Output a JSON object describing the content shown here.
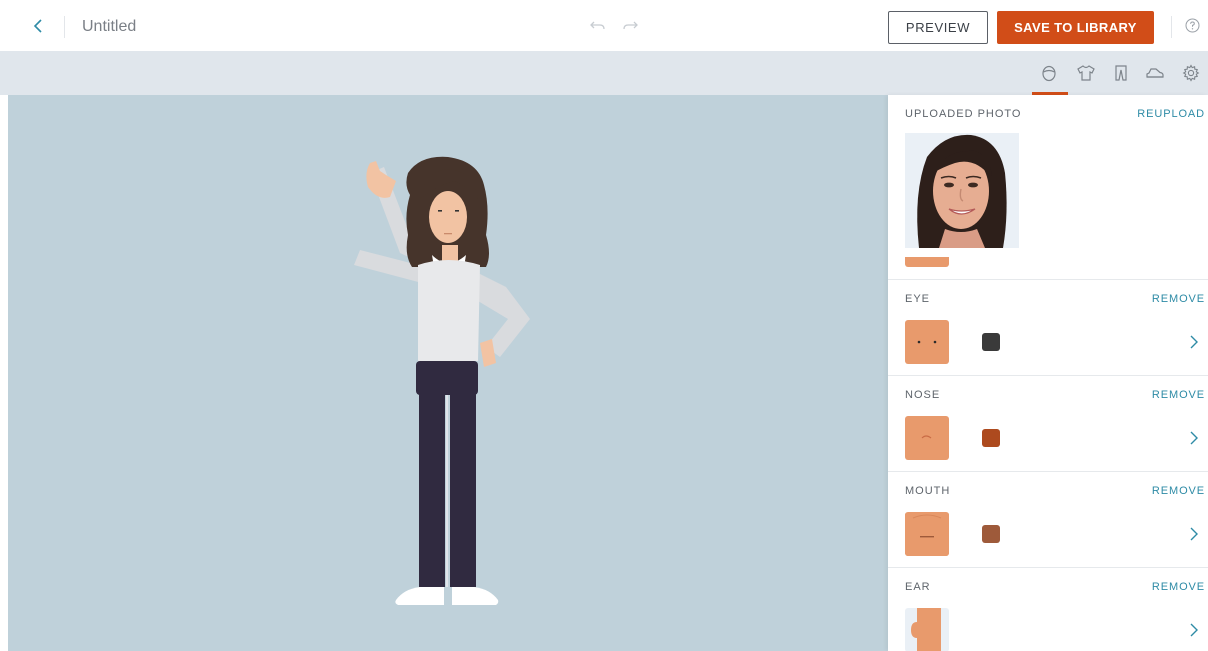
{
  "header": {
    "title": "Untitled",
    "preview_label": "PREVIEW",
    "save_label": "SAVE TO LIBRARY",
    "icons": {
      "back": "chevron-left-icon",
      "undo": "undo-icon",
      "redo": "redo-icon",
      "help": "help-icon"
    }
  },
  "tabs": [
    {
      "name": "face",
      "icon": "face-icon",
      "active": true
    },
    {
      "name": "top",
      "icon": "shirt-icon",
      "active": false
    },
    {
      "name": "bottom",
      "icon": "pants-icon",
      "active": false
    },
    {
      "name": "shoes",
      "icon": "shoe-icon",
      "active": false
    },
    {
      "name": "settings",
      "icon": "gear-icon",
      "active": false
    }
  ],
  "panel": {
    "uploaded_photo": {
      "label": "UPLOADED PHOTO",
      "action": "REUPLOAD"
    },
    "sections": [
      {
        "label": "EYE",
        "action": "REMOVE",
        "color": "#3a3a3a"
      },
      {
        "label": "NOSE",
        "action": "REMOVE",
        "color": "#ad4a1e"
      },
      {
        "label": "MOUTH",
        "action": "REMOVE",
        "color": "#9e5a3a"
      },
      {
        "label": "EAR",
        "action": "REMOVE",
        "color": ""
      }
    ]
  },
  "colors": {
    "accent": "#d14d18",
    "link": "#2e8ba6",
    "canvas_bg": "#bfd1da",
    "skin": "#e89a6c"
  }
}
